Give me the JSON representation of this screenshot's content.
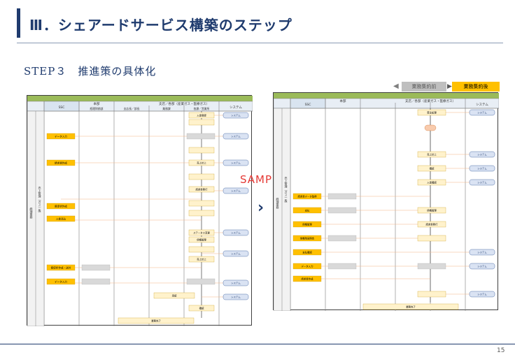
{
  "header": {
    "title": "Ⅲ．シェアードサービス構築のステップ",
    "subtitle": "STEP３　推進策の具体化"
  },
  "legend": {
    "before_label": "業務集約前",
    "after_label": "業務集約後"
  },
  "watermark": "SAMPLE",
  "page_number": "15",
  "left_flow": {
    "columns": [
      "SSC",
      "本部",
      "支店／各部（産業ガス・医療ガス）",
      "",
      "",
      "システム"
    ],
    "subcolumns": [
      "経理財務部",
      "支店長／部長",
      "業務課",
      "各課／営業所"
    ],
    "row_label": "経理業務",
    "side_label": "売上管理（ガス一般）",
    "boxes": [
      "データ入力",
      "請求書作成",
      "督促状作成",
      "入金消込",
      "督促状作成・送付",
      "データ入力",
      "入金登録",
      "売上計上",
      "請求書発行",
      "ステータス変更",
      "債権管理",
      "売上計上",
      "承認",
      "確認",
      "業務完了"
    ],
    "system_boxes": [
      "システム",
      "システム",
      "システム",
      "システム",
      "システム",
      "システム",
      "システム",
      "システム"
    ]
  },
  "right_flow": {
    "columns": [
      "SSC",
      "本部",
      "支店／各部（産業ガス・医療ガス）",
      "",
      "",
      "システム"
    ],
    "row_label": "経理業務",
    "side_label": "売上管理（ガス一般）",
    "boxes": [
      "請求書データ取得",
      "支払",
      "債権管理",
      "債権残高照会",
      "支払確認",
      "データ入力",
      "請求書作成",
      "受注処理",
      "売上計上",
      "確認",
      "入金確認",
      "債権管理",
      "請求書発行",
      "業務完了"
    ],
    "system_boxes": [
      "システム",
      "システム",
      "システム",
      "システム",
      "システム",
      "システム",
      "システム"
    ]
  }
}
